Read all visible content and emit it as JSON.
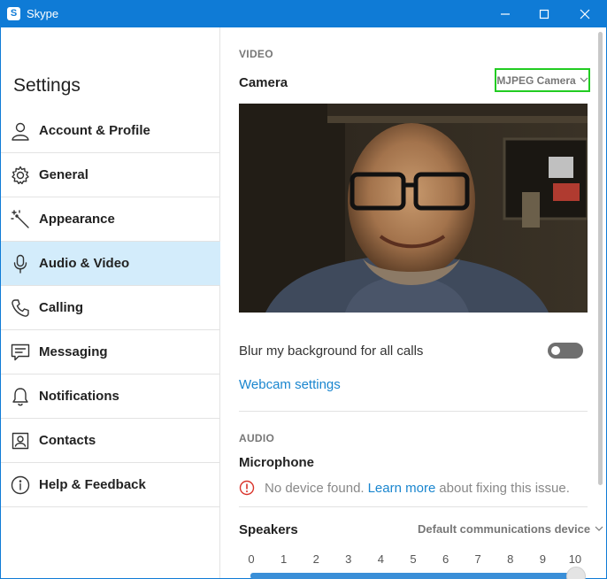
{
  "window": {
    "app_icon_letter": "S",
    "title": "Skype"
  },
  "sidebar": {
    "title": "Settings",
    "items": [
      {
        "label": "Account & Profile",
        "icon": "person-icon",
        "active": false
      },
      {
        "label": "General",
        "icon": "gear-icon",
        "active": false
      },
      {
        "label": "Appearance",
        "icon": "magic-wand-icon",
        "active": false
      },
      {
        "label": "Audio & Video",
        "icon": "microphone-icon",
        "active": true
      },
      {
        "label": "Calling",
        "icon": "phone-icon",
        "active": false
      },
      {
        "label": "Messaging",
        "icon": "chat-icon",
        "active": false
      },
      {
        "label": "Notifications",
        "icon": "bell-icon",
        "active": false
      },
      {
        "label": "Contacts",
        "icon": "contact-card-icon",
        "active": false
      },
      {
        "label": "Help & Feedback",
        "icon": "info-icon",
        "active": false
      }
    ]
  },
  "video": {
    "section_label": "VIDEO",
    "camera_title": "Camera",
    "camera_selected": "MJPEG Camera",
    "blur_label": "Blur my background for all calls",
    "blur_enabled": false,
    "webcam_settings_link": "Webcam settings"
  },
  "audio": {
    "section_label": "AUDIO",
    "microphone_title": "Microphone",
    "mic_message_before": "No device found.",
    "mic_message_link": "Learn more",
    "mic_message_after": "about fixing this issue.",
    "speakers_title": "Speakers",
    "speakers_selected": "Default communications device",
    "scale": [
      "0",
      "1",
      "2",
      "3",
      "4",
      "5",
      "6",
      "7",
      "8",
      "9",
      "10"
    ]
  },
  "colors": {
    "title_bar": "#0f7bd6",
    "active_nav": "#d3ecfb",
    "link": "#1a86cf",
    "highlight_box": "#22cc22",
    "warning": "#d9342b"
  }
}
